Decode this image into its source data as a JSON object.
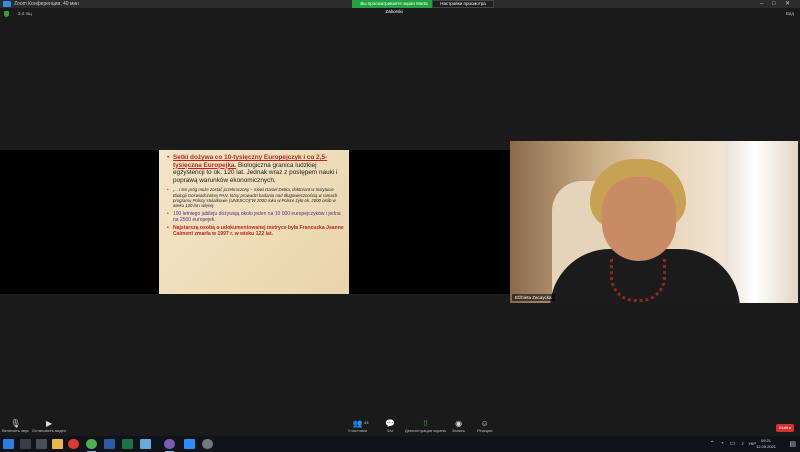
{
  "window": {
    "title": "Zoom Конференция, 40 мин",
    "share_banner": "Вы просматриваете экран Marta Zaborski",
    "view_options": "Настройки просмотра",
    "controls": [
      "–",
      "□",
      "✕"
    ]
  },
  "top_bar": {
    "info": "3,4 ящ",
    "view_label": "Вид"
  },
  "slide": {
    "bullet1_red": "Setki dożywa co 10-tysięczny Europejczyk i co 2,5-tysięczna Europejka.",
    "bullet1_rest": " Biologiczna granica ludzkiej egzystencji to ok. 120 lat. Jednak wraz z postępem nauki i poprawą warunków ekonomicznych,",
    "bullet2": "„... i ten próg może zostać przekroczony – mówi Daniel Detka, doktorant w Instytucie Biologii Doświadczalnej PAN, który prowadzi badania nad długowiecznością w ramach programu Polscy stulatkowie (UNESCO)\"W 2000 roku w Polsce żyło ok. 2000 osób w wieku 100 lat i więcej.",
    "bullet3": "100 letniego jubileju dożywają około jeden na 10 000 europejczyków i jedna na 2500 europejek.",
    "bullet4": "Najstarszą osobą o udokumentowanej metryce była Francuzka Jeanne Calment zmarła w 1997 r. w wieku 122 lat."
  },
  "video": {
    "participant_name": "Elżbieta Zacaycka"
  },
  "toolbar": {
    "mute": "Включить звук",
    "video": "Остановить видео",
    "participants": "Участники",
    "participants_count": "43",
    "chat": "Чат",
    "share": "Демонстрация экрана",
    "record": "Запись",
    "reactions": "Реакции",
    "end": "Выйти"
  },
  "taskbar": {
    "language": "УКР",
    "time": "09:21",
    "date": "12.05.2021"
  }
}
